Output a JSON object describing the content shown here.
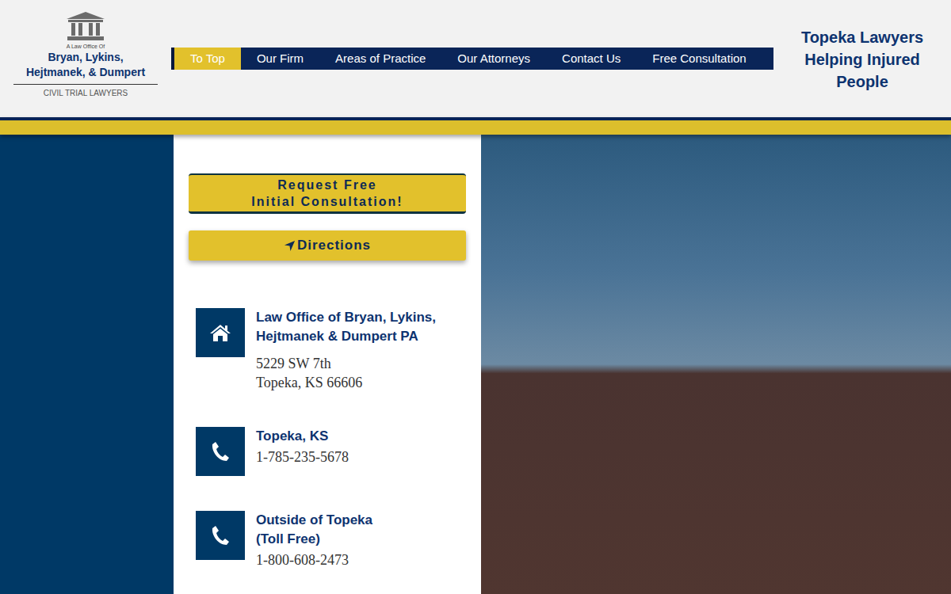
{
  "logo": {
    "prefix": "A Law Office Of",
    "name_lines": [
      "Bryan, Lykins,",
      "Hejtmanek, & Dumpert"
    ],
    "tagline": "CIVIL TRIAL LAWYERS"
  },
  "nav": [
    {
      "label": "To Top",
      "selected": true
    },
    {
      "label": "Our Firm",
      "selected": false
    },
    {
      "label": "Areas of Practice",
      "selected": false
    },
    {
      "label": "Our Attorneys",
      "selected": false
    },
    {
      "label": "Contact Us",
      "selected": false
    },
    {
      "label": "Free Consultation",
      "selected": false
    }
  ],
  "header_tagline": [
    "Topeka Lawyers",
    "Helping Injured",
    "People"
  ],
  "consult_button": [
    "Request Free",
    "Initial Consultation!"
  ],
  "directions_button": "Directions",
  "contacts": [
    {
      "kind": "address",
      "title": [
        "Law Office of Bryan, Lykins,",
        "Hejtmanek & Dumpert PA"
      ],
      "lines": [
        "5229 SW 7th",
        "Topeka, KS 66606"
      ]
    },
    {
      "kind": "phone",
      "title": [
        "Topeka, KS"
      ],
      "lines": [
        "1-785-235-5678"
      ]
    },
    {
      "kind": "phone",
      "title": [
        "Outside of Topeka",
        "(Toll Free)"
      ],
      "lines": [
        "1-800-608-2473"
      ]
    }
  ]
}
